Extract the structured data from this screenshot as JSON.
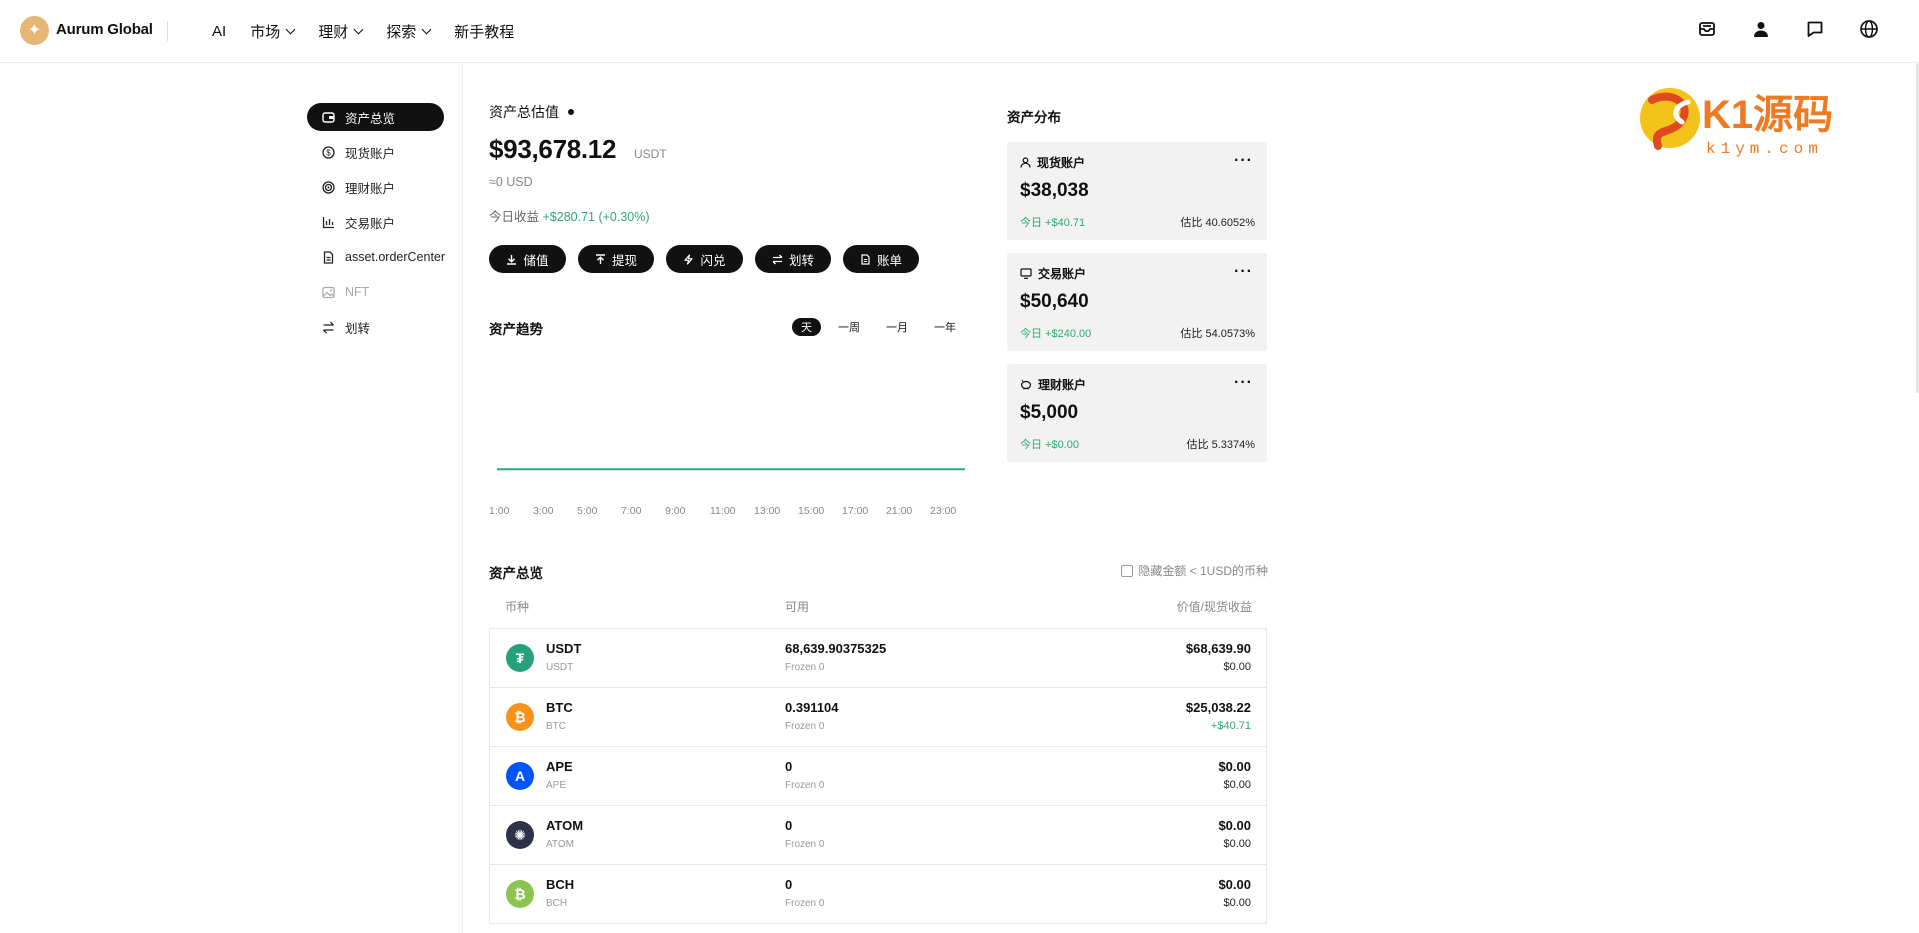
{
  "header": {
    "brand": "Aurum Global",
    "nav": [
      {
        "label": "AI",
        "dropdown": false
      },
      {
        "label": "市场",
        "dropdown": true
      },
      {
        "label": "理财",
        "dropdown": true
      },
      {
        "label": "探索",
        "dropdown": true
      },
      {
        "label": "新手教程",
        "dropdown": false
      }
    ],
    "icons": [
      "inbox-icon",
      "user-icon",
      "message-icon",
      "globe-icon"
    ]
  },
  "sidebar": {
    "items": [
      {
        "label": "资产总览",
        "icon": "wallet-icon",
        "active": true
      },
      {
        "label": "现货账户",
        "icon": "dollar-coin-icon"
      },
      {
        "label": "理财账户",
        "icon": "target-icon"
      },
      {
        "label": "交易账户",
        "icon": "bar-chart-icon"
      },
      {
        "label": "asset.orderCenter",
        "icon": "document-icon"
      },
      {
        "label": "NFT",
        "icon": "image-icon",
        "disabled": true
      },
      {
        "label": "划转",
        "icon": "transfer-icon"
      }
    ]
  },
  "summary": {
    "title": "资产总估值",
    "value": "$93,678.12",
    "unit": "USDT",
    "approx": "≈0 USD",
    "today_label": "今日收益",
    "today_value": "+$280.71",
    "today_pct": "(+0.30%)"
  },
  "actions": [
    {
      "label": "储值",
      "icon": "download-icon"
    },
    {
      "label": "提现",
      "icon": "upload-icon"
    },
    {
      "label": "闪兑",
      "icon": "lightning-icon"
    },
    {
      "label": "划转",
      "icon": "swap-icon"
    },
    {
      "label": "账单",
      "icon": "bill-icon"
    }
  ],
  "trend": {
    "title": "资产趋势",
    "ranges": [
      {
        "label": "天",
        "active": true
      },
      {
        "label": "一周"
      },
      {
        "label": "一月"
      },
      {
        "label": "一年"
      }
    ],
    "ticks": [
      "1:00",
      "3:00",
      "5:00",
      "7:00",
      "9:00",
      "11:00",
      "13:00",
      "15:00",
      "17:00",
      "21:00",
      "23:00"
    ],
    "line_color": "#2fa877"
  },
  "chart_data": {
    "type": "line",
    "title": "",
    "x": [
      "1:00",
      "3:00",
      "5:00",
      "7:00",
      "9:00",
      "11:00",
      "13:00",
      "15:00",
      "17:00",
      "21:00",
      "23:00"
    ],
    "y": [
      93397,
      93410,
      93440,
      93480,
      93520,
      93560,
      93590,
      93620,
      93650,
      93670,
      93678
    ],
    "xlabel": "",
    "ylabel": "",
    "ylim": [
      0,
      1000000
    ],
    "grid": false
  },
  "distribution": {
    "title": "资产分布",
    "cards": [
      {
        "name": "现货账户",
        "icon": "user-icon",
        "value": "$38,038",
        "today": "今日 +$40.71",
        "ratio": "估比 40.6052%"
      },
      {
        "name": "交易账户",
        "icon": "monitor-icon",
        "value": "$50,640",
        "today": "今日 +$240.00",
        "ratio": "估比 54.0573%"
      },
      {
        "name": "理财账户",
        "icon": "piggy-bank-icon",
        "value": "$5,000",
        "today": "今日 +$0.00",
        "ratio": "估比 5.3374%"
      }
    ]
  },
  "watermark": {
    "big": "K1源码",
    "small": "k1ym.com"
  },
  "assets": {
    "title": "资产总览",
    "hide_label": "隐藏金额 < 1USD的币种",
    "headers": {
      "coin": "币种",
      "available": "可用",
      "value": "价值/现货收益"
    },
    "rows": [
      {
        "symbol": "USDT",
        "sub": "USDT",
        "available": "68,639.90375325",
        "frozen": "Frozen 0",
        "value": "$68,639.90",
        "pnl": "$0.00",
        "pnl_positive": false,
        "color": "#26a17b",
        "glyph": "₮"
      },
      {
        "symbol": "BTC",
        "sub": "BTC",
        "available": "0.391104",
        "frozen": "Frozen 0",
        "value": "$25,038.22",
        "pnl": "+$40.71",
        "pnl_positive": true,
        "color": "#f7931a",
        "glyph": "₿"
      },
      {
        "symbol": "APE",
        "sub": "APE",
        "available": "0",
        "frozen": "Frozen 0",
        "value": "$0.00",
        "pnl": "$0.00",
        "pnl_positive": false,
        "color": "#0054f9",
        "glyph": "A"
      },
      {
        "symbol": "ATOM",
        "sub": "ATOM",
        "available": "0",
        "frozen": "Frozen 0",
        "value": "$0.00",
        "pnl": "$0.00",
        "pnl_positive": false,
        "color": "#2e3148",
        "glyph": "✺"
      },
      {
        "symbol": "BCH",
        "sub": "BCH",
        "available": "0",
        "frozen": "Frozen 0",
        "value": "$0.00",
        "pnl": "$0.00",
        "pnl_positive": false,
        "color": "#8dc351",
        "glyph": "₿"
      }
    ]
  }
}
